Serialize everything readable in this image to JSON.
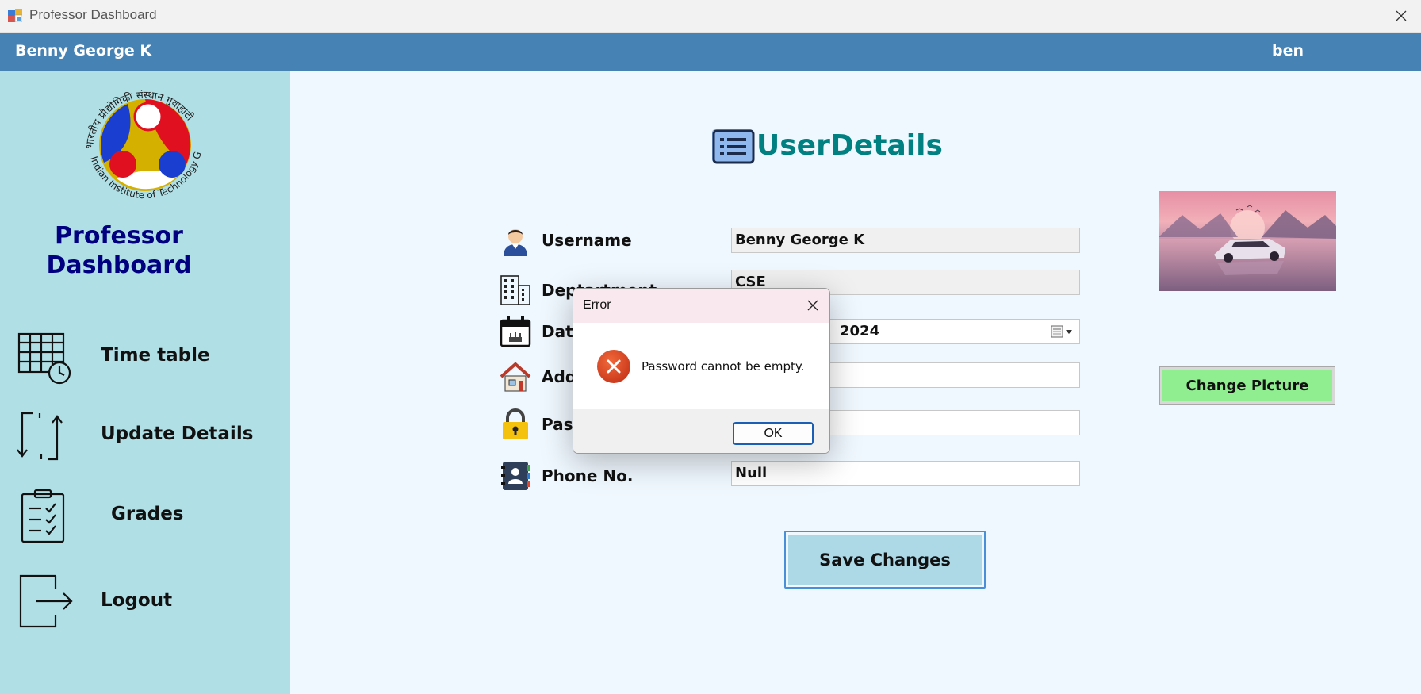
{
  "window": {
    "title": "Professor Dashboard"
  },
  "header": {
    "name": "Benny George K",
    "username": "ben"
  },
  "sidebar": {
    "brand_line1": "Professor",
    "brand_line2": "Dashboard",
    "logo_text": "भारतीय प्रौद्योगिकी संस्थान गुवाहाटी · Indian Institute of Technology Guwahati",
    "items": [
      {
        "label": "Time table",
        "icon": "timetable-icon"
      },
      {
        "label": "Update Details",
        "icon": "update-arrows-icon"
      },
      {
        "label": "Grades",
        "icon": "clipboard-check-icon"
      },
      {
        "label": "Logout",
        "icon": "logout-icon"
      }
    ]
  },
  "main": {
    "title_word1": "User",
    "title_word2": "Details",
    "fields": {
      "username": {
        "label": "Username",
        "value": "Benny George K"
      },
      "department": {
        "label": "Deptartment",
        "value": "CSE"
      },
      "date": {
        "label": "Date",
        "value": "2024"
      },
      "address": {
        "label": "Add",
        "value": ""
      },
      "password": {
        "label": "Pass",
        "value": ""
      },
      "phone": {
        "label": "Phone No.",
        "value": "Null"
      }
    },
    "change_picture": "Change Picture",
    "save_changes": "Save Changes"
  },
  "dialog": {
    "title": "Error",
    "message": "Password cannot be empty.",
    "ok": "OK"
  },
  "colors": {
    "header": "#4682b4",
    "sidebar": "#b0e0e6",
    "main_bg": "#f0f8ff",
    "title_teal": "#008080",
    "brand_navy": "#000080",
    "change_picture": "#90ee90",
    "save_button": "#add8e6",
    "error_red": "#e0481d"
  }
}
